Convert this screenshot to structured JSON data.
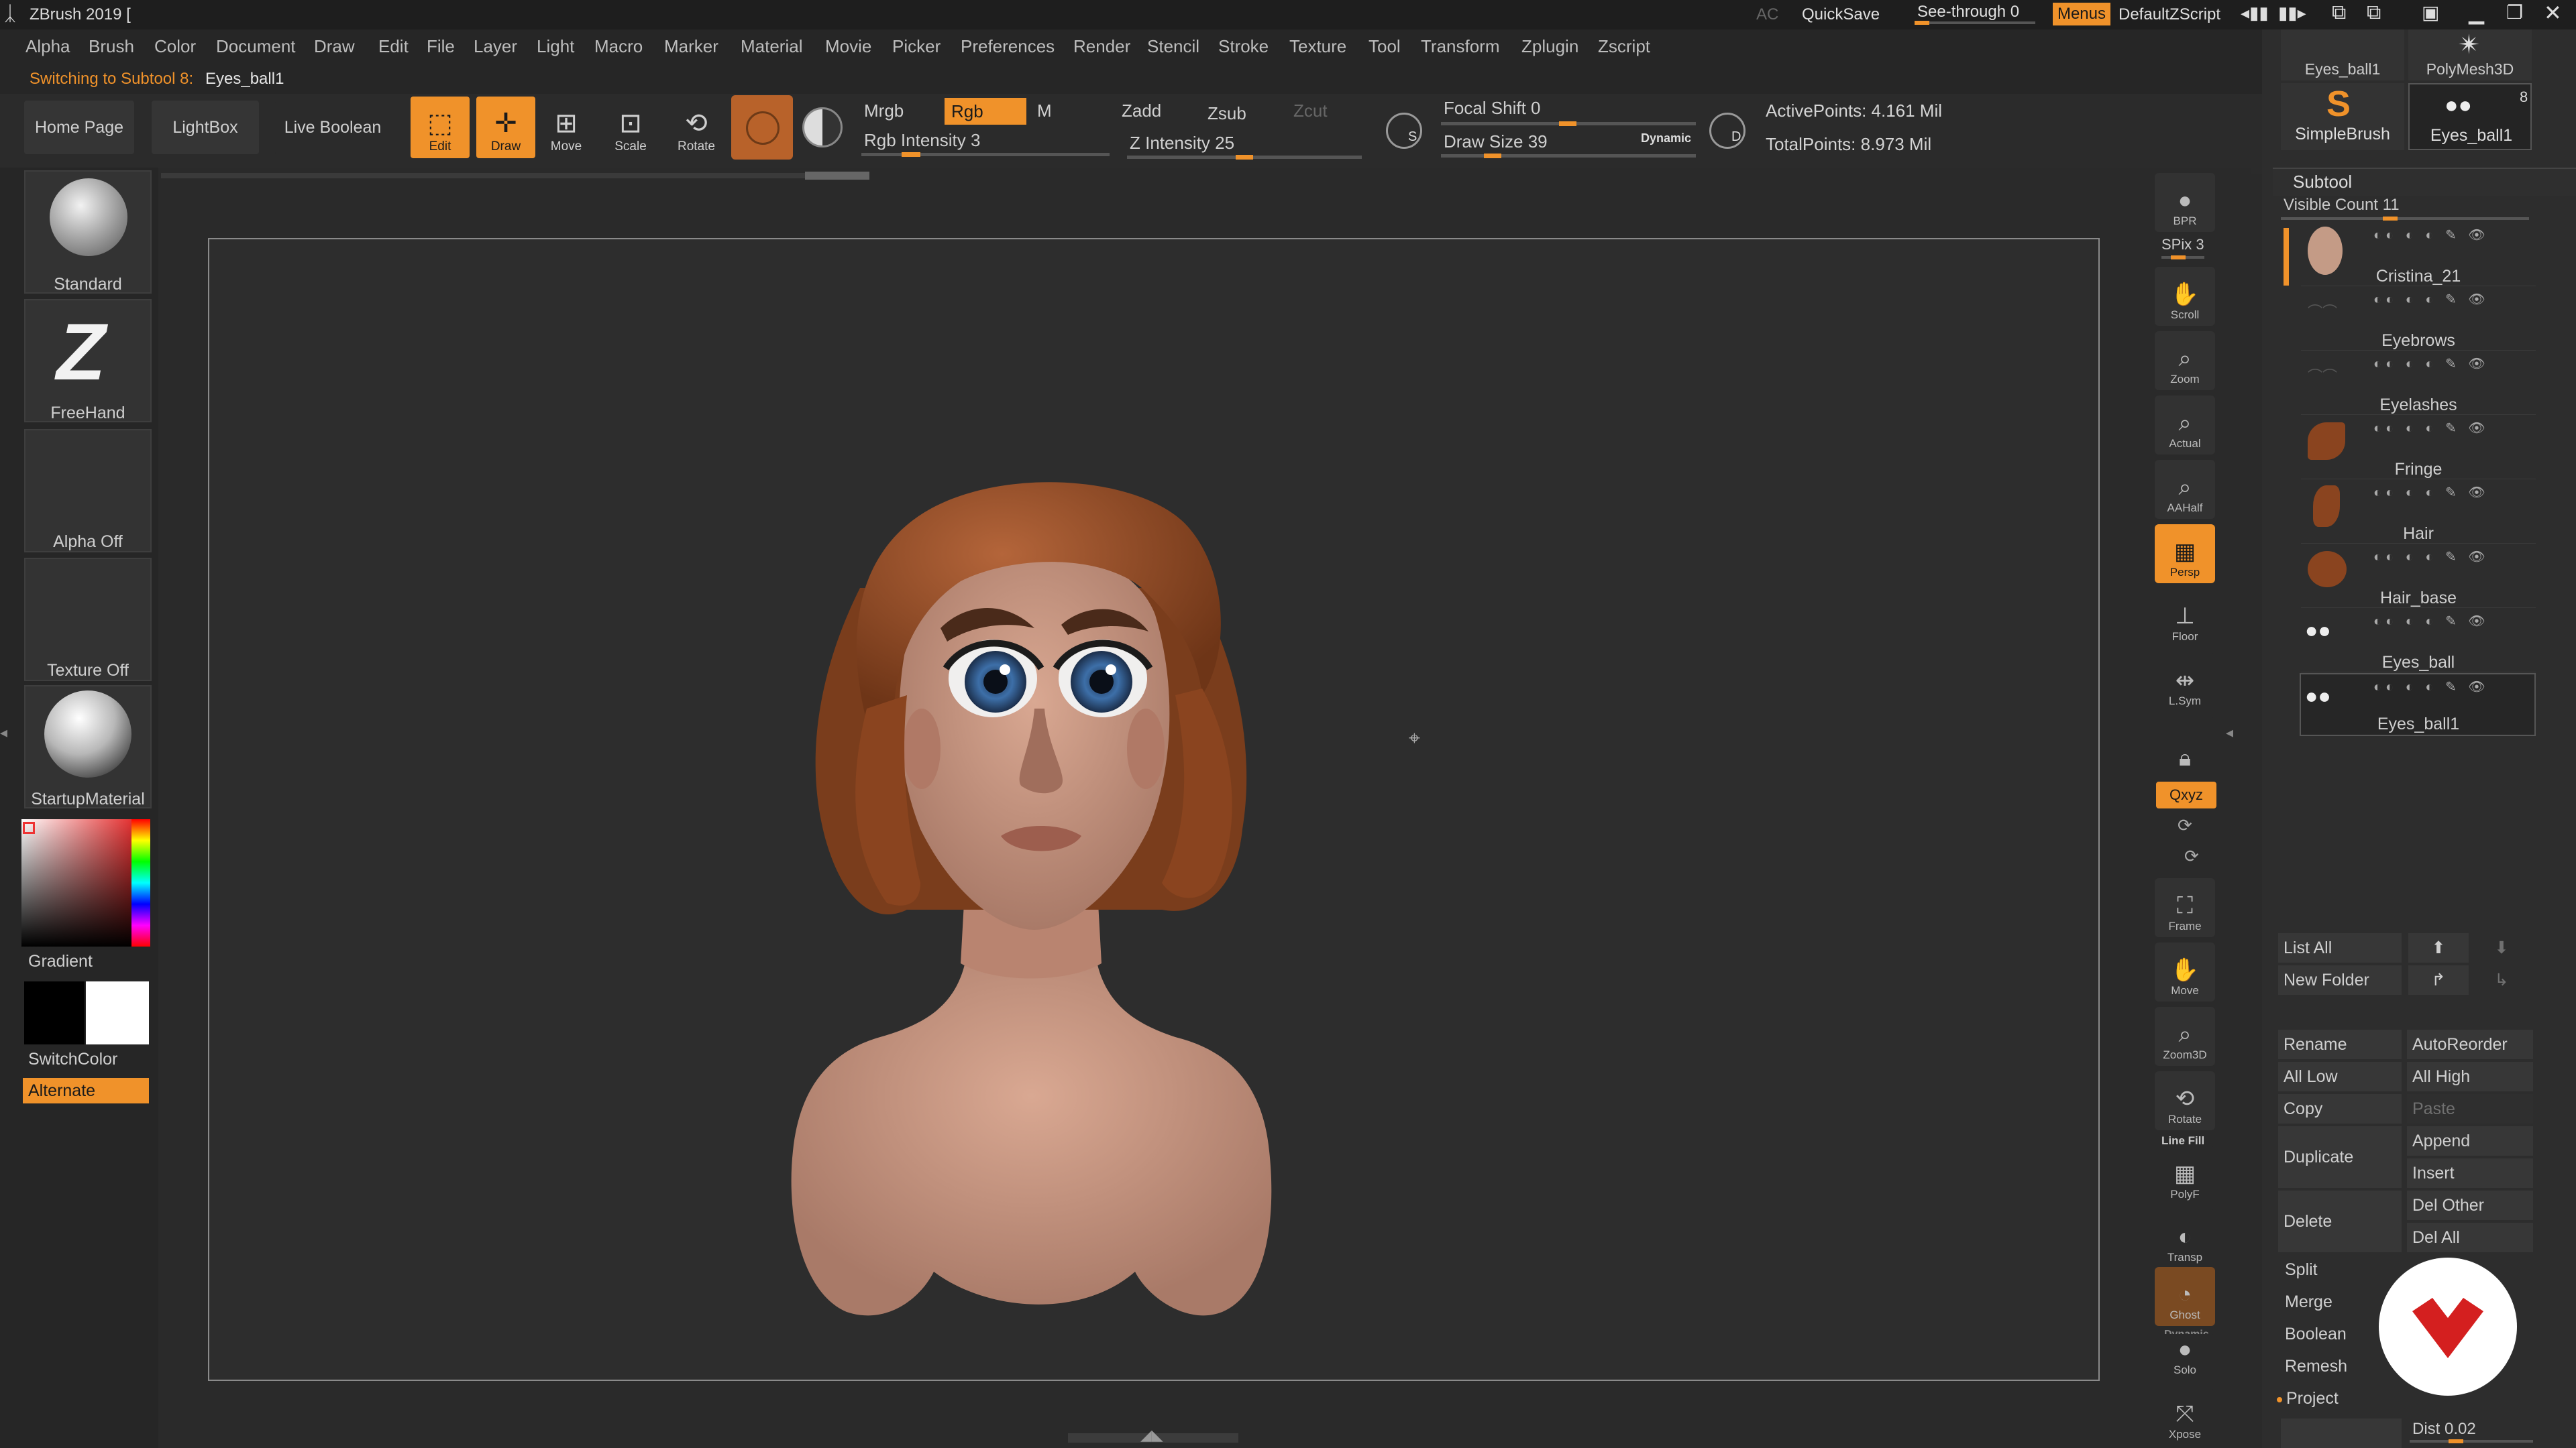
{
  "title_bar": {
    "app_title": "ZBrush 2019 [",
    "ac_label": "AC",
    "quicksave_label": "QuickSave",
    "seethrough_label": "See-through",
    "seethrough_value": "0",
    "menus_label": "Menus",
    "defaultzscript_label": "DefaultZScript"
  },
  "menu": {
    "items": [
      "Alpha",
      "Brush",
      "Color",
      "Document",
      "Draw",
      "Edit",
      "File",
      "Layer",
      "Light",
      "Macro",
      "Marker",
      "Material",
      "Movie",
      "Picker",
      "Preferences",
      "Render",
      "Stencil",
      "Stroke",
      "Texture",
      "Tool",
      "Transform",
      "Zplugin",
      "Zscript"
    ]
  },
  "notification": {
    "message": "Switching to Subtool 8:",
    "subtool": "Eyes_ball1"
  },
  "shelf": {
    "home_page": "Home Page",
    "lightbox": "LightBox",
    "live_boolean": "Live Boolean",
    "edit_label": "Edit",
    "draw_label": "Draw",
    "move_label": "Move",
    "scale_label": "Scale",
    "rotate_label": "Rotate",
    "mrgb_label": "Mrgb",
    "rgb_label": "Rgb",
    "m_label": "M",
    "rgb_intensity_label": "Rgb Intensity 3",
    "zadd_label": "Zadd",
    "zsub_label": "Zsub",
    "zcut_label": "Zcut",
    "z_intensity_label": "Z Intensity 25",
    "focal_shift_label": "Focal Shift 0",
    "draw_size_label": "Draw Size 39",
    "dynamic_label": "Dynamic",
    "active_points": "ActivePoints: 4.161 Mil",
    "total_points": "TotalPoints: 8.973 Mil",
    "s_label": "S",
    "d_label": "D"
  },
  "left_shelf": {
    "brush_label": "Standard",
    "stroke_label": "FreeHand",
    "alpha_label": "Alpha Off",
    "texture_label": "Texture Off",
    "material_label": "StartupMaterial",
    "gradient_label": "Gradient",
    "switchcolor_label": "SwitchColor",
    "alternate_label": "Alternate"
  },
  "right_dock": {
    "bpr": "BPR",
    "spix": "SPix 3",
    "scroll": "Scroll",
    "zoom": "Zoom",
    "actual": "Actual",
    "aahalf": "AAHalf",
    "persp": "Persp",
    "floor": "Floor",
    "lsym": "L.Sym",
    "xyz": "Qxyz",
    "frame": "Frame",
    "move": "Move",
    "zoom3d": "Zoom3D",
    "rotate": "Rotate",
    "linefill": "Line Fill",
    "polyf": "PolyF",
    "transp": "Transp",
    "ghost": "Ghost",
    "dynamic": "Dynamic",
    "solo": "Solo",
    "xpose": "Xpose"
  },
  "tool_panel": {
    "tool1": "Eyes_ball1",
    "tool2": "PolyMesh3D",
    "tool3": "SimpleBrush",
    "tool4": "Eyes_ball1",
    "tool4_count": "8"
  },
  "subtool": {
    "header": "Subtool",
    "visible_count": "Visible Count 11",
    "items": [
      "Cristina_21",
      "Eyebrows",
      "Eyelashes",
      "Fringe",
      "Hair",
      "Hair_base",
      "Eyes_ball",
      "Eyes_ball1"
    ],
    "list_all": "List All",
    "new_folder": "New Folder",
    "rename": "Rename",
    "autoreorder": "AutoReorder",
    "all_low": "All Low",
    "all_high": "All High",
    "copy": "Copy",
    "paste": "Paste",
    "duplicate": "Duplicate",
    "append": "Append",
    "insert": "Insert",
    "delete": "Delete",
    "del_other": "Del Other",
    "del_all": "Del All",
    "split": "Split",
    "merge": "Merge",
    "boolean": "Boolean",
    "remesh": "Remesh",
    "project": "Project",
    "dist": "Dist 0.02"
  },
  "colors": {
    "accent": "#f0922a",
    "panel": "#2d2d2d",
    "background": "#2a2a2a"
  }
}
